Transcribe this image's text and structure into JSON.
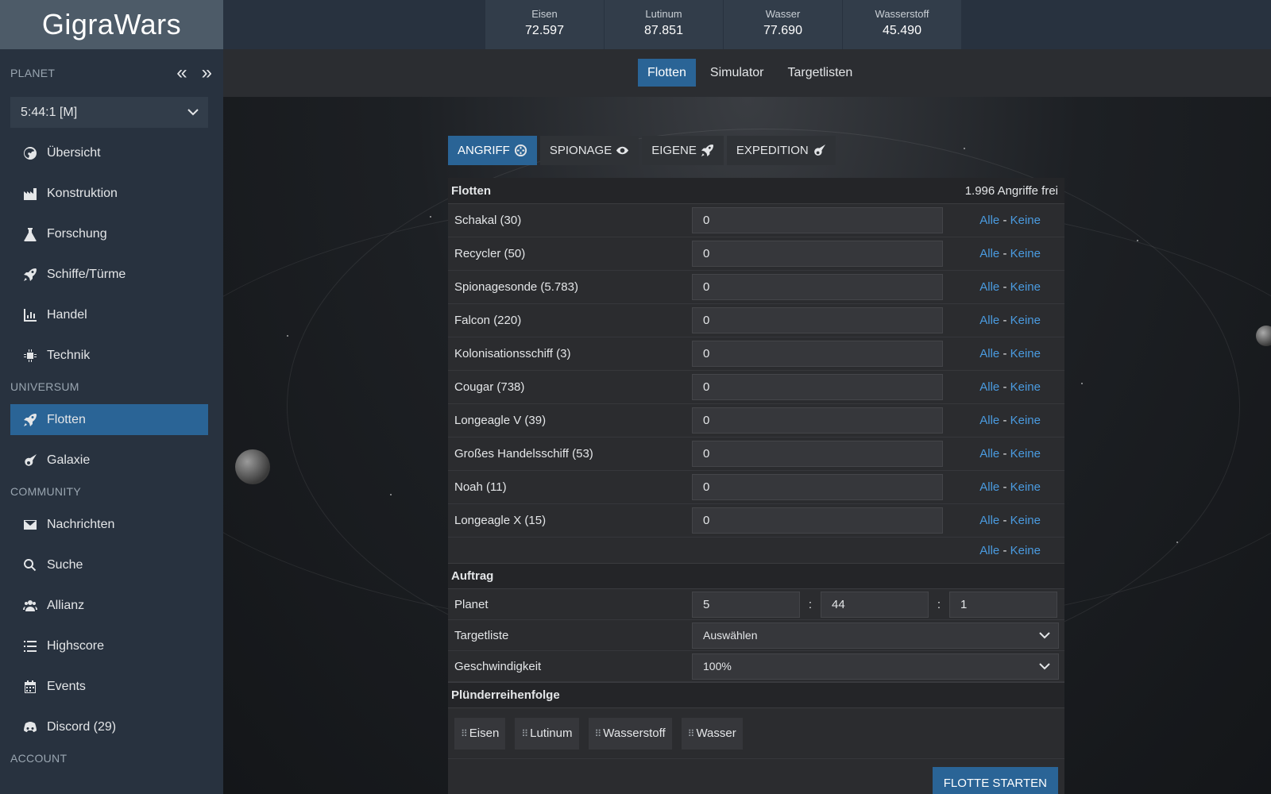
{
  "app": {
    "title": "GigraWars"
  },
  "sidebar": {
    "planet_label": "PLANET",
    "planet_prev": "«",
    "planet_next": "»",
    "planet_selected": "5:44:1 [M]",
    "planet_items": [
      {
        "label": "Übersicht",
        "icon": "globe-icon"
      },
      {
        "label": "Konstruktion",
        "icon": "factory-icon"
      },
      {
        "label": "Forschung",
        "icon": "flask-icon"
      },
      {
        "label": "Schiffe/Türme",
        "icon": "rocket-icon"
      },
      {
        "label": "Handel",
        "icon": "chart-icon"
      },
      {
        "label": "Technik",
        "icon": "chip-icon"
      }
    ],
    "universe_label": "UNIVERSUM",
    "universe_items": [
      {
        "label": "Flotten",
        "icon": "rocket-icon",
        "active": true
      },
      {
        "label": "Galaxie",
        "icon": "comet-icon"
      }
    ],
    "community_label": "COMMUNITY",
    "community_items": [
      {
        "label": "Nachrichten",
        "icon": "envelope-icon"
      },
      {
        "label": "Suche",
        "icon": "search-icon"
      },
      {
        "label": "Allianz",
        "icon": "users-icon"
      },
      {
        "label": "Highscore",
        "icon": "list-icon"
      },
      {
        "label": "Events",
        "icon": "calendar-icon"
      },
      {
        "label": "Discord (29)",
        "icon": "discord-icon"
      }
    ],
    "account_label": "ACCOUNT"
  },
  "resources": [
    {
      "name": "Eisen",
      "value": "72.597"
    },
    {
      "name": "Lutinum",
      "value": "87.851"
    },
    {
      "name": "Wasser",
      "value": "77.690"
    },
    {
      "name": "Wasserstoff",
      "value": "45.490"
    }
  ],
  "subnav": [
    {
      "label": "Flotten",
      "active": true
    },
    {
      "label": "Simulator"
    },
    {
      "label": "Targetlisten"
    }
  ],
  "mode_tabs": [
    {
      "label": "ANGRIFF",
      "icon": "crosshair-icon",
      "active": true
    },
    {
      "label": "SPIONAGE",
      "icon": "eye-icon"
    },
    {
      "label": "EIGENE",
      "icon": "rocket-icon"
    },
    {
      "label": "EXPEDITION",
      "icon": "comet-icon"
    }
  ],
  "fleet": {
    "header": "Flotten",
    "free_attacks": "1.996 Angriffe frei",
    "all_label": "Alle",
    "separator": "-",
    "none_label": "Keine",
    "ships": [
      {
        "name": "Schakal (30)",
        "value": "0"
      },
      {
        "name": "Recycler (50)",
        "value": "0"
      },
      {
        "name": "Spionagesonde (5.783)",
        "value": "0"
      },
      {
        "name": "Falcon (220)",
        "value": "0"
      },
      {
        "name": "Kolonisationsschiff (3)",
        "value": "0"
      },
      {
        "name": "Cougar (738)",
        "value": "0"
      },
      {
        "name": "Longeagle V (39)",
        "value": "0"
      },
      {
        "name": "Großes Handelsschiff (53)",
        "value": "0"
      },
      {
        "name": "Noah (11)",
        "value": "0"
      },
      {
        "name": "Longeagle X (15)",
        "value": "0"
      }
    ]
  },
  "order": {
    "header": "Auftrag",
    "planet_label": "Planet",
    "coord_sep": ":",
    "galaxy": "5",
    "system": "44",
    "position": "1",
    "targetlist_label": "Targetliste",
    "targetlist_value": "Auswählen",
    "speed_label": "Geschwindigkeit",
    "speed_value": "100%"
  },
  "loot": {
    "header": "Plünderreihenfolge",
    "items": [
      "Eisen",
      "Lutinum",
      "Wasserstoff",
      "Wasser"
    ]
  },
  "submit_label": "FLOTTE STARTEN"
}
